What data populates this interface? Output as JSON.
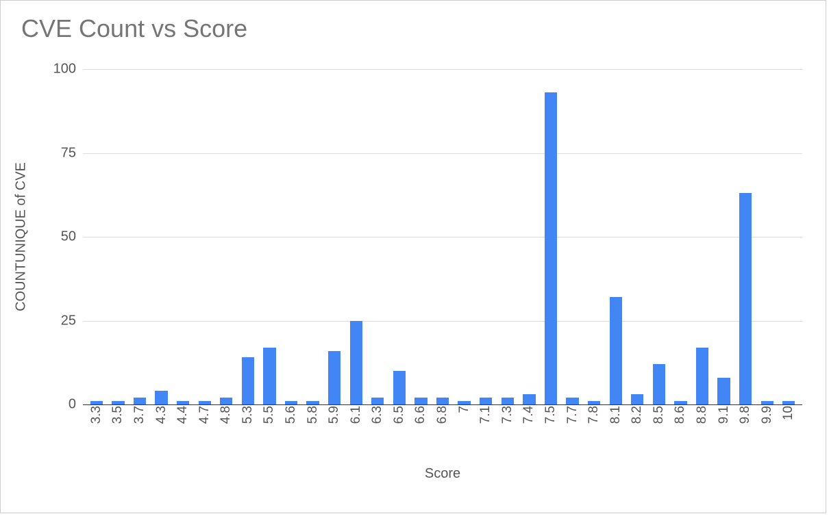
{
  "chart_data": {
    "type": "bar",
    "title": "CVE Count vs Score",
    "xlabel": "Score",
    "ylabel": "COUNTUNIQUE of CVE",
    "ylim": [
      0,
      100
    ],
    "yticks": [
      0,
      25,
      50,
      75,
      100
    ],
    "categories": [
      "3.3",
      "3.5",
      "3.7",
      "4.3",
      "4.4",
      "4.7",
      "4.8",
      "5.3",
      "5.5",
      "5.6",
      "5.8",
      "5.9",
      "6.1",
      "6.3",
      "6.5",
      "6.6",
      "6.8",
      "7",
      "7.1",
      "7.3",
      "7.4",
      "7.5",
      "7.7",
      "7.8",
      "8.1",
      "8.2",
      "8.5",
      "8.6",
      "8.8",
      "9.1",
      "9.8",
      "9.9",
      "10"
    ],
    "values": [
      1,
      1,
      2,
      4,
      1,
      1,
      2,
      14,
      17,
      1,
      1,
      16,
      25,
      2,
      10,
      2,
      2,
      1,
      2,
      2,
      3,
      93,
      2,
      1,
      32,
      3,
      12,
      1,
      17,
      8,
      63,
      1,
      1
    ]
  }
}
